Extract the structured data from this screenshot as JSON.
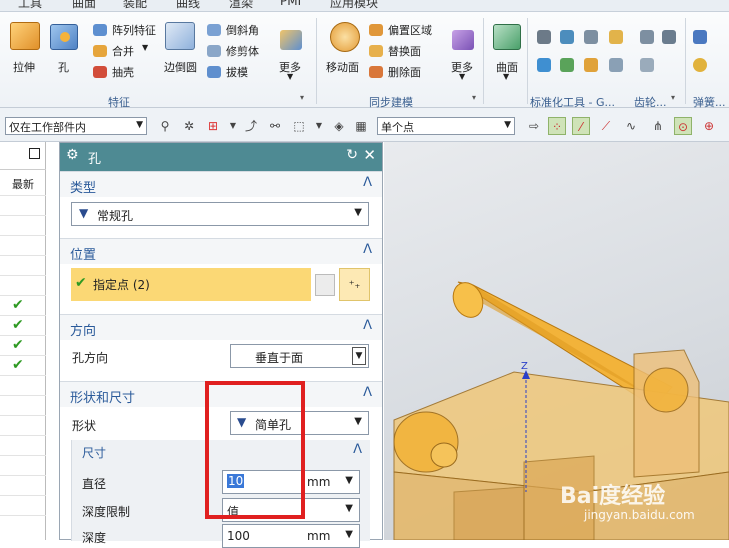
{
  "menu": [
    "工具",
    "曲面",
    "装配",
    "曲线",
    "渲染",
    "PMI",
    "应用模块"
  ],
  "ribbon": {
    "big_buttons": [
      {
        "label": "拉伸",
        "icon": "extrude-icon"
      },
      {
        "label": "孔",
        "icon": "hole-icon"
      },
      {
        "label": "边倒圆",
        "icon": "edge-blend-icon"
      },
      {
        "label": "更多",
        "icon": "more-icon"
      },
      {
        "label": "移动面",
        "icon": "move-face-icon"
      },
      {
        "label": "更多",
        "icon": "more-icon"
      },
      {
        "label": "曲面",
        "icon": "surface-icon"
      }
    ],
    "small_buttons": [
      "阵列特征",
      "合并",
      "抽壳",
      "倒斜角",
      "修剪体",
      "拔模",
      "偏置区域",
      "替换面",
      "删除面"
    ],
    "groups": [
      "特征",
      "同步建模",
      "标准化工具 - G...",
      "齿轮...",
      "弹簧..."
    ]
  },
  "selection_bar": {
    "filter": "仅在工作部件内",
    "snap": "单个点"
  },
  "left_panel": {
    "header": "最新",
    "checks": [
      "✔",
      "✔",
      "✔",
      "✔"
    ]
  },
  "dialog": {
    "title": "孔",
    "sections": {
      "type": {
        "label": "类型",
        "value": "常规孔"
      },
      "position": {
        "label": "位置",
        "specify_point": "指定点 (2)"
      },
      "direction": {
        "label": "方向",
        "field": "孔方向",
        "value": "垂直于面"
      },
      "shape": {
        "label": "形状和尺寸",
        "field": "形状",
        "value": "简单孔"
      },
      "dims": {
        "label": "尺寸",
        "diameter_label": "直径",
        "diameter": "10",
        "diameter_unit": "mm",
        "depth_limit_label": "深度限制",
        "depth_limit": "值",
        "depth_label": "深度",
        "depth": "100",
        "depth_unit": "mm"
      }
    }
  },
  "viewport": {
    "axis_label": "Z",
    "watermark": "Bai度经验",
    "watermark_url": "jingyan.baidu.com"
  },
  "colors": {
    "dialog_title": "#4e8a93",
    "highlight": "#fbd875",
    "part": "#f2b33a",
    "red_box": "#e02020"
  }
}
